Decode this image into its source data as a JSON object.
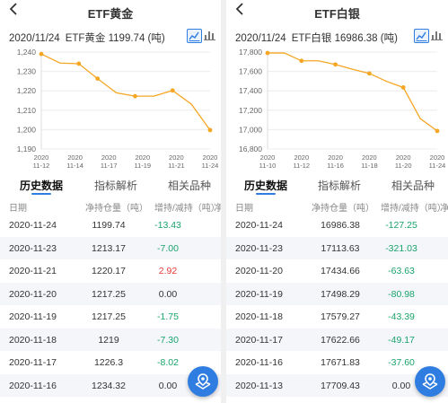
{
  "panels": [
    {
      "title": "ETF黄金",
      "summary_date": "2020/11/24",
      "summary_text": "ETF黄金 1199.74 (吨)",
      "chart_data": {
        "type": "line",
        "x": [
          "2020 11-12",
          "2020 11-13",
          "2020 11-16",
          "2020 11-17",
          "2020 11-18",
          "2020 11-19",
          "2020 11-20",
          "2020 11-21",
          "2020 11-23",
          "2020 11-24"
        ],
        "values": [
          1239.0,
          1234.32,
          1234.0,
          1226.3,
          1219,
          1217.25,
          1217.25,
          1220.17,
          1213.17,
          1199.74
        ],
        "tick_labels": [
          "2020 11-12",
          "2020 11-14",
          "2020 11-17",
          "2020 11-19",
          "2020 11-21",
          "2020 11-24"
        ],
        "y_ticks": [
          "1,240",
          "1,230",
          "1,220",
          "1,210",
          "1,200",
          "1,190"
        ],
        "ylim": [
          1190,
          1240
        ],
        "line_color": "#f5a623",
        "marked": [
          0,
          2,
          3,
          5,
          7,
          9
        ]
      },
      "tabs": [
        "历史数据",
        "指标解析",
        "相关品种"
      ],
      "columns": [
        "日期",
        "净持仓量（吨）",
        "增持/减持（吨）",
        "净"
      ],
      "rows": [
        {
          "date": "2020-11-24",
          "holding": "1199.74",
          "change": "-13.43",
          "dir": "green"
        },
        {
          "date": "2020-11-23",
          "holding": "1213.17",
          "change": "-7.00",
          "dir": "green"
        },
        {
          "date": "2020-11-21",
          "holding": "1220.17",
          "change": "2.92",
          "dir": "red"
        },
        {
          "date": "2020-11-20",
          "holding": "1217.25",
          "change": "0.00",
          "dir": ""
        },
        {
          "date": "2020-11-19",
          "holding": "1217.25",
          "change": "-1.75",
          "dir": "green"
        },
        {
          "date": "2020-11-18",
          "holding": "1219",
          "change": "-7.30",
          "dir": "green"
        },
        {
          "date": "2020-11-17",
          "holding": "1226.3",
          "change": "-8.02",
          "dir": "green"
        },
        {
          "date": "2020-11-16",
          "holding": "1234.32",
          "change": "0.00",
          "dir": ""
        }
      ]
    },
    {
      "title": "ETF白银",
      "summary_date": "2020/11/24",
      "summary_text": "ETF白银 16986.38 (吨)",
      "chart_data": {
        "type": "line",
        "x": [
          "2020 11-10",
          "2020 11-11",
          "2020 11-12",
          "2020 11-13",
          "2020 11-16",
          "2020 11-17",
          "2020 11-18",
          "2020 11-19",
          "2020 11-20",
          "2020 11-23",
          "2020 11-24"
        ],
        "values": [
          17790,
          17790,
          17709.43,
          17709.43,
          17671.83,
          17622.66,
          17579.27,
          17498.29,
          17434.66,
          17113.63,
          16986.38
        ],
        "tick_labels": [
          "2020 11-10",
          "2020 11-12",
          "2020 11-16",
          "2020 11-18",
          "2020 11-20",
          "2020 11-24"
        ],
        "y_ticks": [
          "17,800",
          "17,600",
          "17,400",
          "17,200",
          "17,000",
          "16,800"
        ],
        "ylim": [
          16800,
          17800
        ],
        "line_color": "#f5a623",
        "marked": [
          0,
          2,
          4,
          6,
          8,
          10
        ]
      },
      "tabs": [
        "历史数据",
        "指标解析",
        "相关品种"
      ],
      "columns": [
        "日期",
        "净持仓量（吨）",
        "增持/减持（吨）",
        "净"
      ],
      "rows": [
        {
          "date": "2020-11-24",
          "holding": "16986.38",
          "change": "-127.25",
          "dir": "green"
        },
        {
          "date": "2020-11-23",
          "holding": "17113.63",
          "change": "-321.03",
          "dir": "green"
        },
        {
          "date": "2020-11-20",
          "holding": "17434.66",
          "change": "-63.63",
          "dir": "green"
        },
        {
          "date": "2020-11-19",
          "holding": "17498.29",
          "change": "-80.98",
          "dir": "green"
        },
        {
          "date": "2020-11-18",
          "holding": "17579.27",
          "change": "-43.39",
          "dir": "green"
        },
        {
          "date": "2020-11-17",
          "holding": "17622.66",
          "change": "-49.17",
          "dir": "green"
        },
        {
          "date": "2020-11-16",
          "holding": "17671.83",
          "change": "-37.60",
          "dir": "green"
        },
        {
          "date": "2020-11-13",
          "holding": "17709.43",
          "change": "0.00",
          "dir": ""
        }
      ]
    }
  ],
  "icons": {
    "back": "back-arrow-icon",
    "line_chart": "line-chart-icon",
    "bar_chart": "bar-chart-icon",
    "fab": "map-locate-icon"
  },
  "accent": "#2f7de1"
}
